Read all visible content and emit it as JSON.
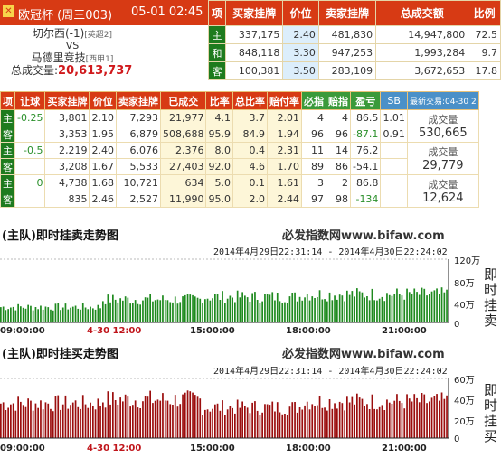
{
  "header": {
    "title": "欧冠杯 (周三003)",
    "datetime": "05-01 02:45",
    "home": "切尔西(-1)",
    "home_league": "[英超2]",
    "vs": "VS",
    "away": "马德里竞技",
    "away_league": "[西甲1]",
    "total_label": "总成交量:",
    "total_value": "20,613,737"
  },
  "summary": {
    "columns": [
      "项",
      "买家挂牌",
      "价位",
      "卖家挂牌",
      "总成交额",
      "比例"
    ],
    "rows": [
      {
        "label": "主",
        "buy": "337,175",
        "price": "2.40",
        "sell": "481,830",
        "total": "14,947,800",
        "ratio": "72.5"
      },
      {
        "label": "和",
        "buy": "848,118",
        "price": "3.30",
        "sell": "947,253",
        "total": "1,993,284",
        "ratio": "9.7"
      },
      {
        "label": "客",
        "buy": "100,381",
        "price": "3.50",
        "sell": "283,109",
        "total": "3,672,653",
        "ratio": "17.8"
      }
    ]
  },
  "detail": {
    "columns": [
      "项",
      "让球",
      "买家挂牌",
      "价位",
      "卖家挂牌",
      "已成交",
      "比率",
      "总比率",
      "赔付率",
      "必指",
      "赔指",
      "盈亏",
      "SB",
      "最新交易:04-30 2"
    ],
    "rows": [
      {
        "label": "主",
        "hcap": "-0.25",
        "buy": "3,801",
        "price": "2.10",
        "sell": "7,293",
        "done": "21,977",
        "rate": "4.1",
        "trate": "3.7",
        "pay": "2.01",
        "bz": "4",
        "pz": "4",
        "pl": "86.5",
        "sb": "1.01"
      },
      {
        "label": "客",
        "hcap": "",
        "buy": "3,353",
        "price": "1.95",
        "sell": "6,879",
        "done": "508,688",
        "rate": "95.9",
        "trate": "84.9",
        "pay": "1.94",
        "bz": "96",
        "pz": "96",
        "pl": "-87.1",
        "sb": "0.91"
      },
      {
        "label": "主",
        "hcap": "-0.5",
        "buy": "2,219",
        "price": "2.40",
        "sell": "6,076",
        "done": "2,376",
        "rate": "8.0",
        "trate": "0.4",
        "pay": "2.31",
        "bz": "11",
        "pz": "14",
        "pl": "76.2",
        "sb": ""
      },
      {
        "label": "客",
        "hcap": "",
        "buy": "3,208",
        "price": "1.67",
        "sell": "5,533",
        "done": "27,403",
        "rate": "92.0",
        "trate": "4.6",
        "pay": "1.70",
        "bz": "89",
        "pz": "86",
        "pl": "-54.1",
        "sb": ""
      },
      {
        "label": "主",
        "hcap": "0",
        "buy": "4,738",
        "price": "1.68",
        "sell": "10,721",
        "done": "634",
        "rate": "5.0",
        "trate": "0.1",
        "pay": "1.61",
        "bz": "3",
        "pz": "2",
        "pl": "86.8",
        "sb": ""
      },
      {
        "label": "客",
        "hcap": "",
        "buy": "835",
        "price": "2.46",
        "sell": "2,527",
        "done": "11,990",
        "rate": "95.0",
        "trate": "2.0",
        "pay": "2.44",
        "bz": "97",
        "pz": "98",
        "pl": "-134",
        "sb": ""
      }
    ],
    "volumes": [
      {
        "label": "成交量",
        "value": "530,665"
      },
      {
        "label": "成交量",
        "value": "29,779"
      },
      {
        "label": "成交量",
        "value": "12,624"
      }
    ]
  },
  "chart1": {
    "title": "(主队)即时挂卖走势图",
    "site": "必发指数网www.bifaw.com",
    "range": "2014年4月29日22:31:14 - 2014年4月30日22:24:02",
    "ylabel": "即时挂卖",
    "yticks": [
      "120万",
      "80万",
      "40万",
      "0"
    ],
    "xticks": [
      "09:00:00",
      "4-30 12:00",
      "15:00:00",
      "18:00:00",
      "21:00:00"
    ],
    "color": "#1f8a1f"
  },
  "chart2": {
    "title": "(主队)即时挂买走势图",
    "site": "必发指数网www.bifaw.com",
    "range": "2014年4月29日22:31:14 - 2014年4月30日22:24:02",
    "ylabel": "即时挂买",
    "yticks": [
      "60万",
      "40万",
      "20万",
      "0"
    ],
    "xticks": [
      "09:00:00",
      "4-30 12:00",
      "15:00:00",
      "18:00:00",
      "21:00:00"
    ],
    "color": "#9b0d0d"
  },
  "chart_data": [
    {
      "type": "bar",
      "title": "(主队)即时挂卖走势图",
      "ylabel": "即时挂卖",
      "ylim": [
        0,
        1200000
      ],
      "x_range": [
        "09:00:00",
        "22:24:02"
      ],
      "values_wan_segments": [
        {
          "from": "09:00",
          "to": "12:00",
          "approx": 30
        },
        {
          "from": "12:00",
          "to": "15:00",
          "approx": 45
        },
        {
          "from": "15:00",
          "to": "18:00",
          "approx": 50
        },
        {
          "from": "18:00",
          "to": "22:24",
          "approx": 55
        }
      ]
    },
    {
      "type": "bar",
      "title": "(主队)即时挂买走势图",
      "ylabel": "即时挂买",
      "ylim": [
        0,
        600000
      ],
      "x_range": [
        "09:00:00",
        "22:24:02"
      ],
      "values_wan_segments": [
        {
          "from": "09:00",
          "to": "12:00",
          "approx": 36
        },
        {
          "from": "12:00",
          "to": "15:00",
          "approx": 40
        },
        {
          "from": "15:00",
          "to": "18:00",
          "approx": 32
        },
        {
          "from": "18:00",
          "to": "22:24",
          "approx": 38
        }
      ]
    }
  ]
}
